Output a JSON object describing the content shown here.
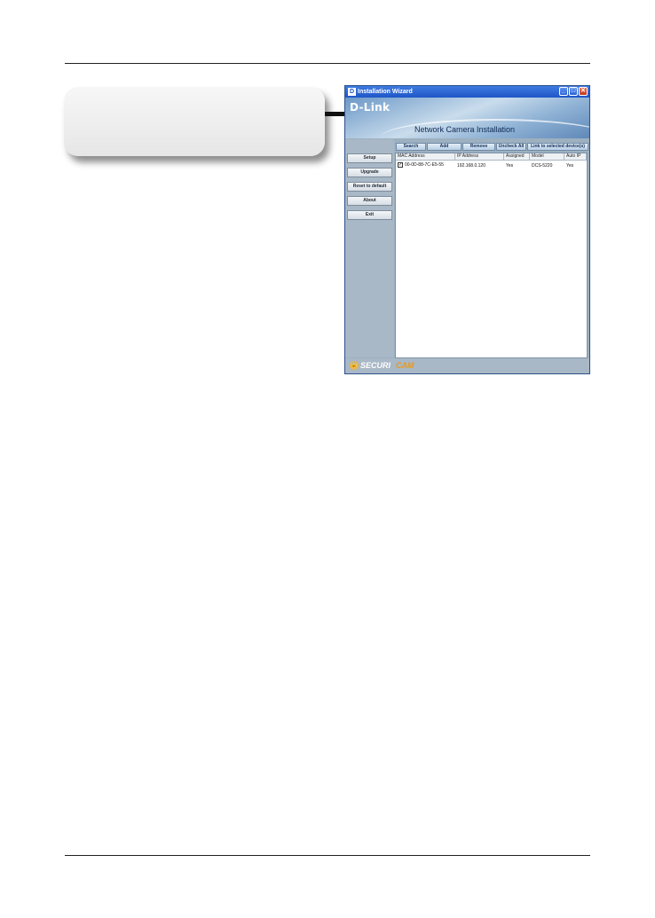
{
  "window": {
    "icon_letter": "D",
    "title": "Installation Wizard",
    "minimize": "_",
    "maximize": "□",
    "close": "✕"
  },
  "banner": {
    "logo": "D-Link",
    "subtitle": "Network Camera Installation"
  },
  "sidebar": {
    "items": [
      "Setup",
      "Upgrade",
      "Reset to default",
      "About",
      "Exit"
    ]
  },
  "toolbar": {
    "buttons": [
      "Search",
      "Add",
      "Remove",
      "Uncheck All",
      "Link to selected device(s)"
    ]
  },
  "table": {
    "columns": [
      "MAC Address",
      "IP Address",
      "Assigned",
      "Model",
      "Auto IP"
    ],
    "rows": [
      {
        "checked": "✓",
        "mac": "00-0D-88-7C-E5-55",
        "ip": "192.168.0.120",
        "assigned": "Yes",
        "model": "DCS-5220",
        "auto_ip": "Yes"
      }
    ]
  },
  "footer": {
    "brand_part1": "SECURI",
    "brand_part2": "CAM",
    "lock_glyph": "🔒"
  }
}
